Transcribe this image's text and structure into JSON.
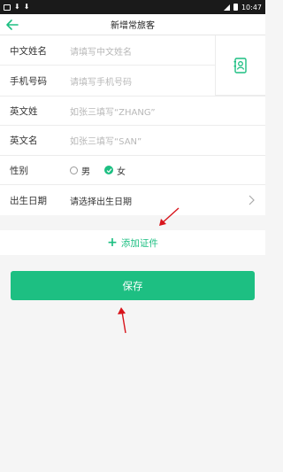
{
  "statusbar": {
    "time": "10:47"
  },
  "navbar": {
    "title": "新增常旅客"
  },
  "form": {
    "chinese_name": {
      "label": "中文姓名",
      "placeholder": "请填写中文姓名"
    },
    "phone": {
      "label": "手机号码",
      "placeholder": "请填写手机号码"
    },
    "surname_en": {
      "label": "英文姓",
      "placeholder": "如张三填写“ZHANG”"
    },
    "given_en": {
      "label": "英文名",
      "placeholder": "如张三填写“SAN”"
    },
    "gender": {
      "label": "性别",
      "options": [
        "男",
        "女"
      ],
      "selected": "女"
    },
    "birthdate": {
      "label": "出生日期",
      "placeholder": "请选择出生日期"
    }
  },
  "add_certificate": {
    "label": "添加证件"
  },
  "save_button": {
    "label": "保存"
  },
  "colors": {
    "accent": "#1dbf82",
    "annotation": "#d8141b"
  },
  "icons": [
    "download-icon",
    "back-arrow-icon",
    "contacts-icon",
    "chevron-right-icon",
    "plus-icon",
    "check-icon"
  ]
}
